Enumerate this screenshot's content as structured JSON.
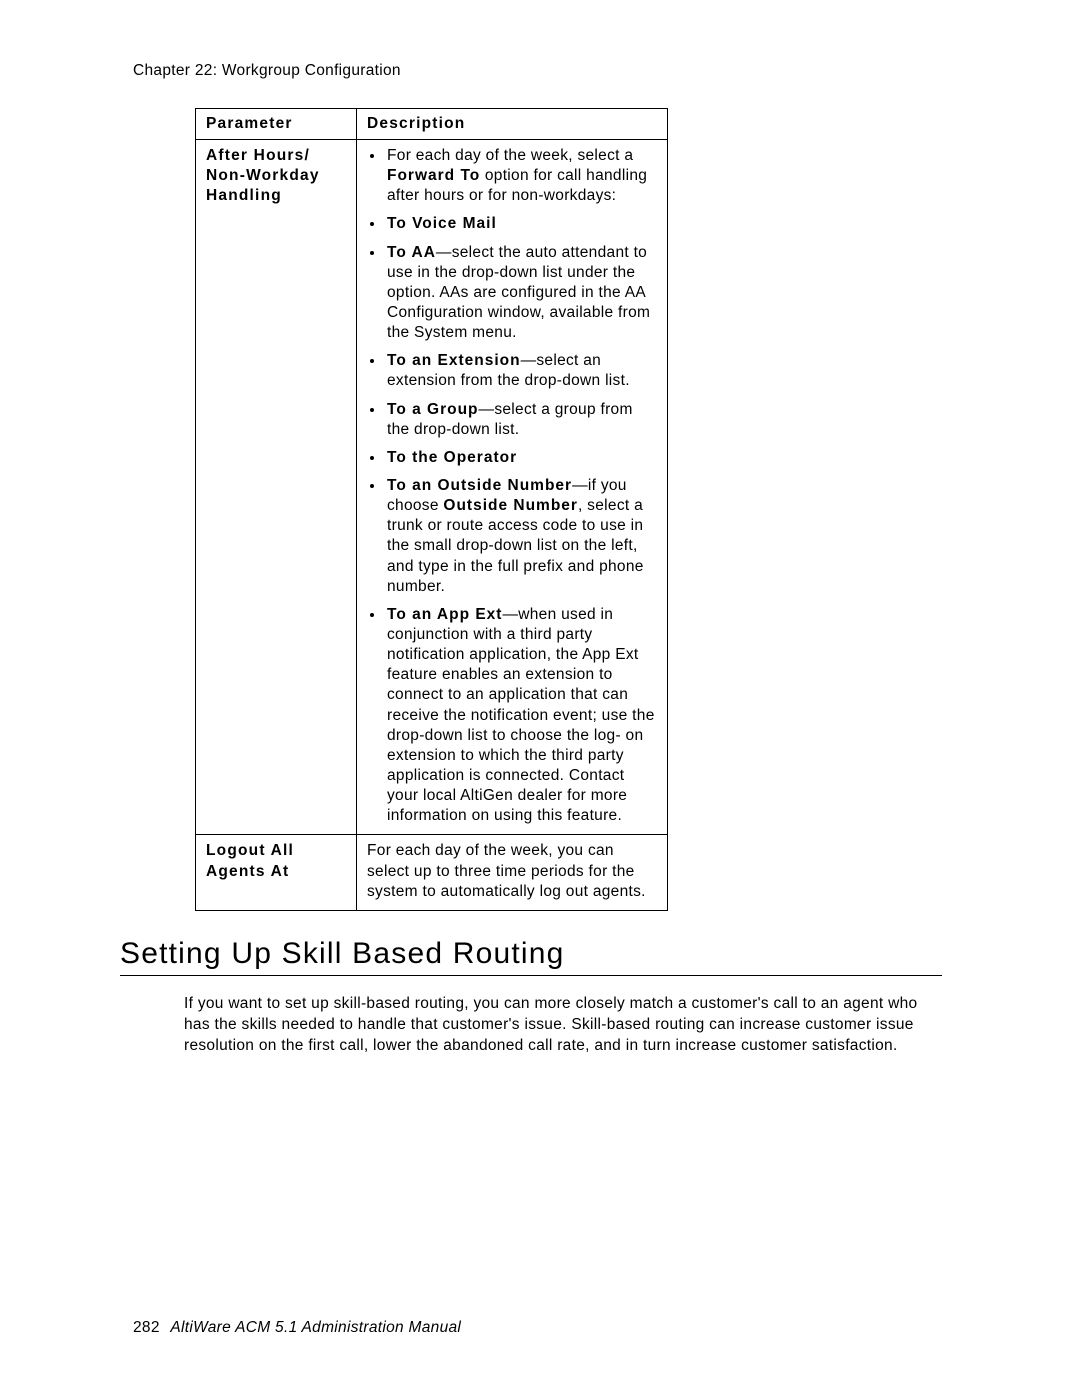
{
  "header": {
    "chapter": "Chapter 22:  Workgroup Configuration"
  },
  "table": {
    "head": {
      "param": "Parameter",
      "desc": "Description"
    },
    "rows": [
      {
        "param_label": "After Hours/ Non-Workday Handling",
        "bullets": [
          {
            "pre": "For each day of the week, select a ",
            "bold": "Forward To",
            "post": " option for call handling after hours or for non-workdays:"
          },
          {
            "pre": "",
            "bold": "To Voice Mail",
            "post": ""
          },
          {
            "pre": "",
            "bold": "To AA",
            "post": "—select the auto attendant to use in the drop-down list under the option. AAs are configured in the AA Configuration window, available from the System menu."
          },
          {
            "pre": "",
            "bold": "To an Extension",
            "post": "—select an extension from the drop-down list."
          },
          {
            "pre": "",
            "bold": "To a Group",
            "post": "—select a group from the drop-down list."
          },
          {
            "pre": "",
            "bold": "To the Operator",
            "post": ""
          },
          {
            "pre": "",
            "bold": "To an Outside Number",
            "post2_pre": "—if you choose ",
            "bold2": "Outside Number",
            "post2": ", select a trunk or route access code to use in the small drop-down list on the left, and type in the full prefix and phone number."
          },
          {
            "pre": "",
            "bold": "To an App Ext",
            "post": "—when used in conjunction with a third party notification application, the App Ext feature enables an extension to connect to an application that can receive the notification event; use the drop-down list to choose the log- on extension to which the third party application is connected. Contact your local AltiGen dealer for more information on using this feature."
          }
        ]
      },
      {
        "param_label": "Logout All Agents At",
        "plain": "For each day of the week, you can select up to three time periods for the system to automatically log out agents."
      }
    ]
  },
  "section": {
    "heading": "Setting Up Skill Based Routing",
    "paragraph": "If you want to set up skill-based routing, you can more closely match a customer's call to an agent who has the skills needed to handle that customer's issue. Skill-based routing can increase customer issue resolution on the first call, lower the abandoned call rate, and in turn increase customer satisfaction."
  },
  "footer": {
    "page_number": "282",
    "manual": "AltiWare ACM 5.1 Administration Manual"
  }
}
